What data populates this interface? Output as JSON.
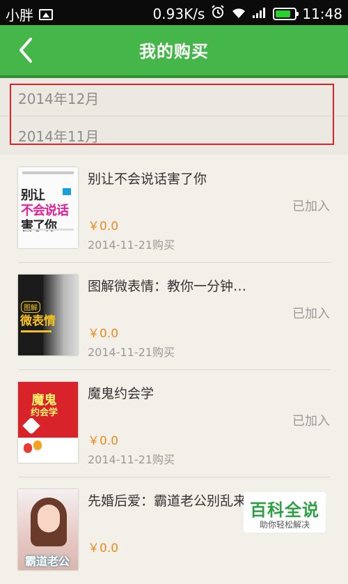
{
  "status_bar": {
    "carrier": "小胖",
    "speed": "0.93K/s",
    "time": "11:48",
    "battery_color": "#29d12f"
  },
  "header": {
    "title": "我的购买",
    "back_icon": "chevron-left-icon",
    "bg_color": "#45b649"
  },
  "month_filter": {
    "items": [
      "2014年12月",
      "2014年11月"
    ]
  },
  "purchases": [
    {
      "title": "别让不会说话害了你",
      "price": "￥0.0",
      "date": "2014-11-21购买",
      "status": "已加入",
      "cover_text": [
        "别让",
        "不会说话",
        "害了你"
      ]
    },
    {
      "title": "图解微表情：教你一分钟…",
      "price": "￥0.0",
      "date": "2014-11-21购买",
      "status": "已加入",
      "cover_text": [
        "图解",
        "微表情"
      ]
    },
    {
      "title": "魔鬼约会学",
      "price": "￥0.0",
      "date": "2014-11-21购买",
      "status": "已加入",
      "cover_text": [
        "魔鬼",
        "约会学"
      ]
    },
    {
      "title": "先婚后爱：霸道老公别乱来",
      "price": "￥0.0",
      "date": "",
      "status": "",
      "cover_text": [
        "霸道老公"
      ]
    }
  ],
  "watermark": {
    "title": "百科全说",
    "subtitle": "助你轻松解决"
  },
  "colors": {
    "accent_green": "#45b649",
    "price_orange": "#f08a1d",
    "highlight_red": "#d9222a"
  }
}
